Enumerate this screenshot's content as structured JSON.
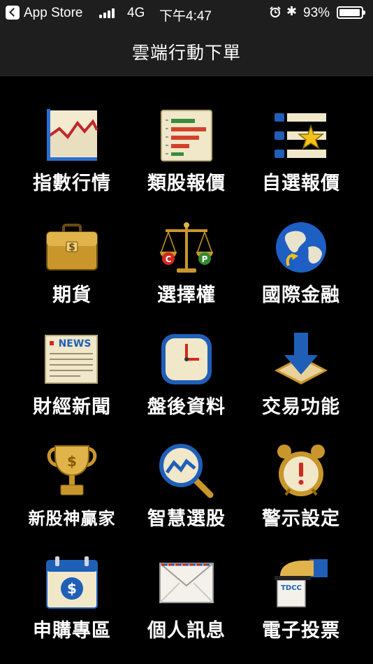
{
  "status_bar": {
    "back_app": "App Store",
    "network": "4G",
    "time": "下午4:47",
    "battery": "93%"
  },
  "nav": {
    "title": "雲端行動下單"
  },
  "menu": [
    {
      "label": "指數行情",
      "icon": "index-chart-icon"
    },
    {
      "label": "類股報價",
      "icon": "sector-bars-icon"
    },
    {
      "label": "自選報價",
      "icon": "watchlist-star-icon"
    },
    {
      "label": "期貨",
      "icon": "briefcase-dollar-icon"
    },
    {
      "label": "選擇權",
      "icon": "scale-cp-icon"
    },
    {
      "label": "國際金融",
      "icon": "globe-icon"
    },
    {
      "label": "財經新聞",
      "icon": "news-icon"
    },
    {
      "label": "盤後資料",
      "icon": "clock-icon"
    },
    {
      "label": "交易功能",
      "icon": "down-arrow-tray-icon"
    },
    {
      "label": "新股神贏家",
      "icon": "trophy-dollar-icon"
    },
    {
      "label": "智慧選股",
      "icon": "magnifier-chart-icon"
    },
    {
      "label": "警示設定",
      "icon": "alarm-clock-icon"
    },
    {
      "label": "申購專區",
      "icon": "calendar-dollar-icon"
    },
    {
      "label": "個人訊息",
      "icon": "envelope-icon"
    },
    {
      "label": "電子投票",
      "icon": "tdcc-vote-icon"
    }
  ],
  "icon_labels": {
    "news": "NEWS",
    "call": "C",
    "put": "P",
    "tdcc": "TDCC",
    "dollar": "$"
  },
  "colors": {
    "background": "#000000",
    "bar": "#1e1e1e",
    "text": "#ffffff"
  }
}
